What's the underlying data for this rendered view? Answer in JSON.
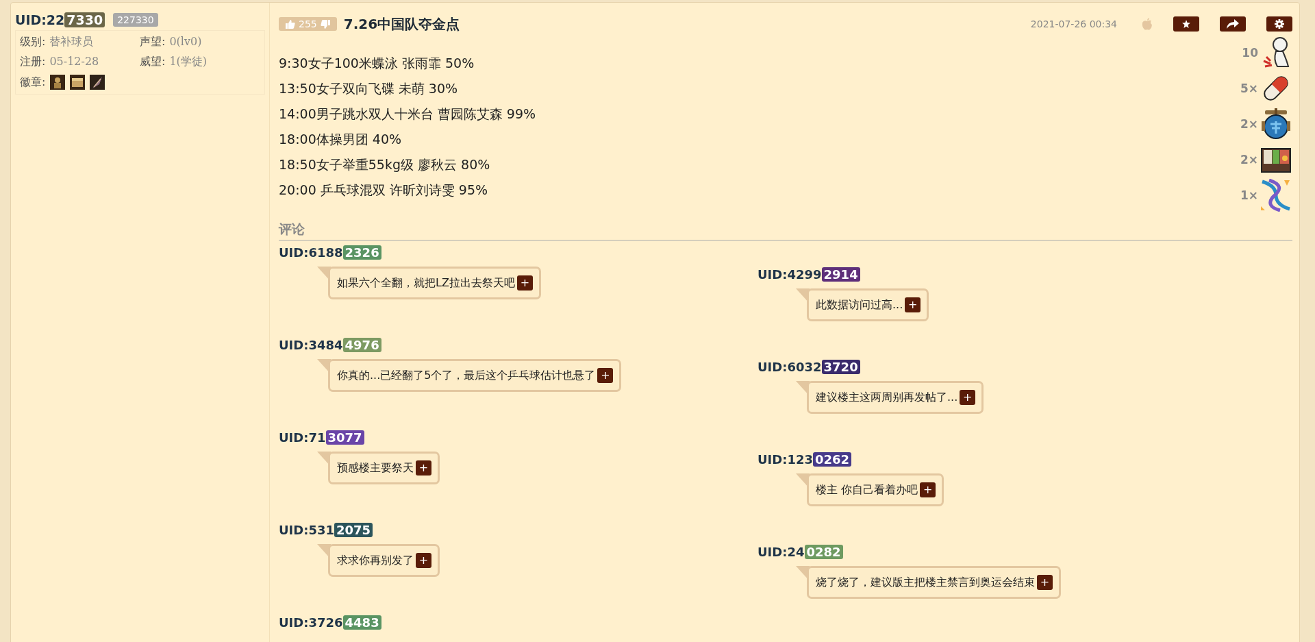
{
  "author": {
    "uid_prefix": "UID:22",
    "uid_badge": "7330",
    "color": "#6b6648",
    "uid_full": "227330",
    "fields": [
      {
        "label": "级别:",
        "value": "替补球员"
      },
      {
        "label": "声望:",
        "value": "0(lv0)"
      },
      {
        "label": "注册:",
        "value": "05-12-28"
      },
      {
        "label": "威望:",
        "value": "1(学徒)"
      }
    ],
    "medals_label": "徽章:",
    "medals": [
      {
        "kind": "statue"
      },
      {
        "kind": "chest"
      },
      {
        "kind": "feather"
      }
    ]
  },
  "post": {
    "votes": "255",
    "title": "7.26中国队夺金点",
    "date": "2021-07-26 00:34",
    "lines": [
      "9:30女子100米蝶泳 张雨霏 50%",
      "13:50女子双向飞碟 未萌 30%",
      "14:00男子跳水双人十米台 曹园陈艾森 99%",
      "18:00体操男团 40%",
      "18:50女子举重55kg级 廖秋云 80%",
      "20:00 乒乓球混双 许昕刘诗雯 95%"
    ],
    "rewards": [
      {
        "count": "10",
        "kind": "figure"
      },
      {
        "count": "5×",
        "kind": "capsule"
      },
      {
        "count": "2×",
        "kind": "jar"
      },
      {
        "count": "2×",
        "kind": "bento"
      },
      {
        "count": "1×",
        "kind": "helix"
      }
    ]
  },
  "comments_heading": "评论",
  "comments": [
    {
      "uid": "UID:6188",
      "badge": "2326",
      "color": "#5a9463",
      "text": "如果六个全翻，就把LZ拉出去祭天吧",
      "more": "+"
    },
    {
      "uid": "UID:4299",
      "badge": "2914",
      "color": "#5e2f7a",
      "text": "此数据访问过高...",
      "more": "+"
    },
    {
      "uid": "UID:3484",
      "badge": "4976",
      "color": "#7d9a62",
      "text": "你真的...已经翻了5个了，最后这个乒乓球估计也悬了",
      "more": "+"
    },
    {
      "uid": "UID:6032",
      "badge": "3720",
      "color": "#3a2b6c",
      "text": "建议楼主这两周别再发帖了...",
      "more": "+"
    },
    {
      "uid": "UID:71",
      "badge": "3077",
      "color": "#6a45a8",
      "text": "预感楼主要祭天",
      "more": "+"
    },
    {
      "uid": "UID:123",
      "badge": "0262",
      "color": "#473a8a",
      "text": "楼主 你自己看着办吧",
      "more": "+"
    },
    {
      "uid": "UID:531",
      "badge": "2075",
      "color": "#2c555c",
      "text": "求求你再别发了",
      "more": "+"
    },
    {
      "uid": "UID:24",
      "badge": "0282",
      "color": "#6e9a60",
      "text": "烧了烧了，建议版主把楼主禁言到奥运会结束",
      "more": "+"
    },
    {
      "uid": "UID:3726",
      "badge": "4483",
      "color": "#5a9463"
    }
  ]
}
